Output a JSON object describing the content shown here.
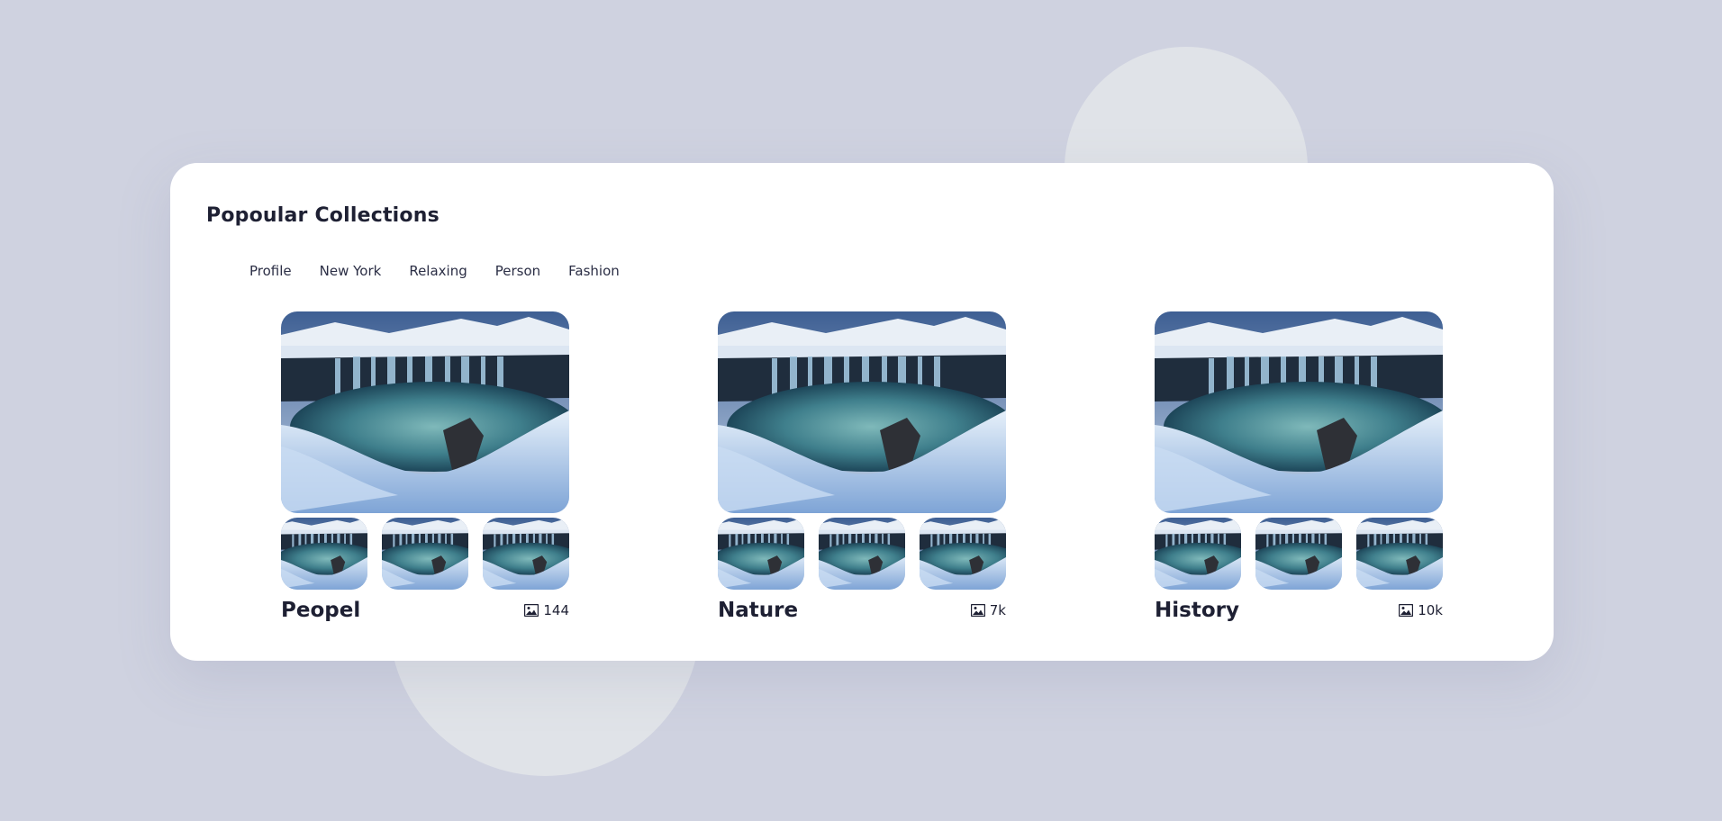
{
  "page": {
    "title": "Popoular Collections"
  },
  "tabs": [
    {
      "label": "Profile"
    },
    {
      "label": "New York"
    },
    {
      "label": "Relaxing"
    },
    {
      "label": "Person"
    },
    {
      "label": "Fashion"
    }
  ],
  "collections": [
    {
      "name": "Peopel",
      "count": "144"
    },
    {
      "name": "Nature",
      "count": "7k"
    },
    {
      "name": "History",
      "count": "10k"
    }
  ],
  "icons": {
    "count": "image-icon"
  },
  "colors": {
    "background": "#cfd2e0",
    "card": "#ffffff",
    "text": "#1e2033",
    "blob": "#e0e3e8"
  }
}
